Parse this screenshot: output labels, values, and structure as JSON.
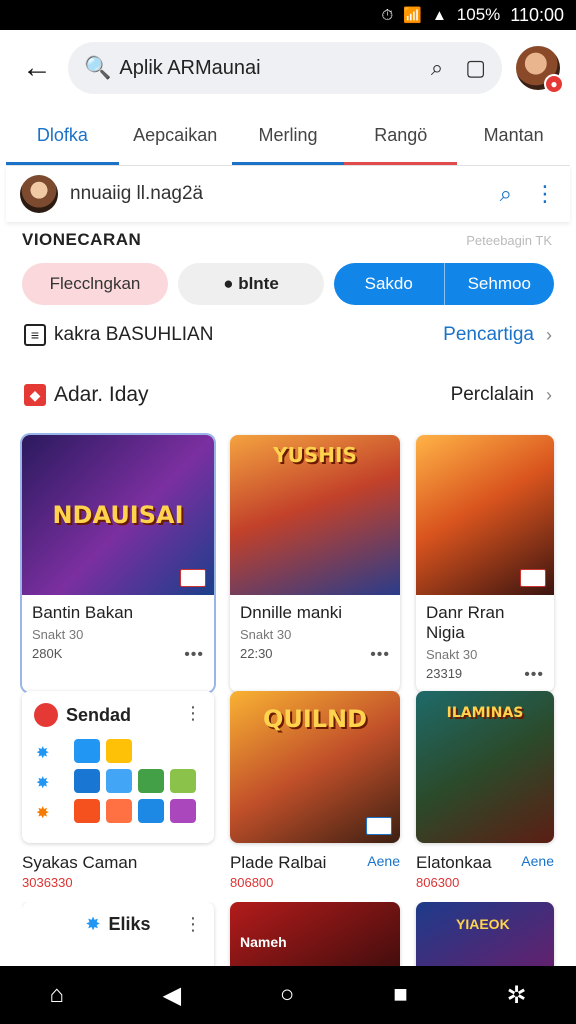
{
  "status": {
    "battery": "105%",
    "time": "110:00"
  },
  "search": {
    "value": "Aplik ARMaunai"
  },
  "tabs": [
    {
      "label": "Dlofka",
      "active": true,
      "underline": "#1a73c8"
    },
    {
      "label": "Aepcaikan",
      "active": false,
      "underline": ""
    },
    {
      "label": "Merling",
      "active": false,
      "underline": "#1a73c8"
    },
    {
      "label": "Rangö",
      "active": false,
      "underline": "#e04a4a"
    },
    {
      "label": "Mantan",
      "active": false,
      "underline": ""
    }
  ],
  "channel": {
    "name": "nnuaiig ll.nag2ä"
  },
  "section": {
    "title": "VIONECARAN",
    "hint": "Peteebagin TK"
  },
  "chips": {
    "pink": "Flecclngkan",
    "grey": "blnte",
    "blue_left": "Sakdo",
    "blue_right": "Sehmoo"
  },
  "row1": {
    "label": "kakra BASUHLIAN",
    "more": "Pencartiga"
  },
  "row2": {
    "label": "Adar. Iday",
    "more": "Perclalain"
  },
  "games_row1": [
    {
      "logo": "NDAUISAI",
      "name": "Bantin Bakan",
      "sub": "Snakt 30",
      "count": "280K"
    },
    {
      "logo": "YUSHIS",
      "name": "Dnnille manki",
      "sub": "Snakt 30",
      "count": "22:30"
    },
    {
      "logo": "",
      "name": "Danr Rran Nigia",
      "sub": "Snakt 30",
      "count": "23319"
    }
  ],
  "app_tile": {
    "title": "Sendad",
    "caption": "Syakas Caman",
    "sub": "3036330"
  },
  "games_row2": [
    {
      "logo": "QUILND",
      "name": "Plade Ralbai",
      "tag": "Aene",
      "sub": "806800"
    },
    {
      "logo": "ILAMINAS",
      "name": "Elatonkaa",
      "tag": "Aene",
      "sub": "806300"
    }
  ],
  "row3": {
    "tile_title": "Eliks",
    "g1": "Nameh",
    "g2": "YIAEOK"
  },
  "colors": {
    "accent": "#1a73c8",
    "chip_blue": "#1185e8",
    "chip_pink": "#fbd8dc",
    "danger": "#e53935"
  }
}
